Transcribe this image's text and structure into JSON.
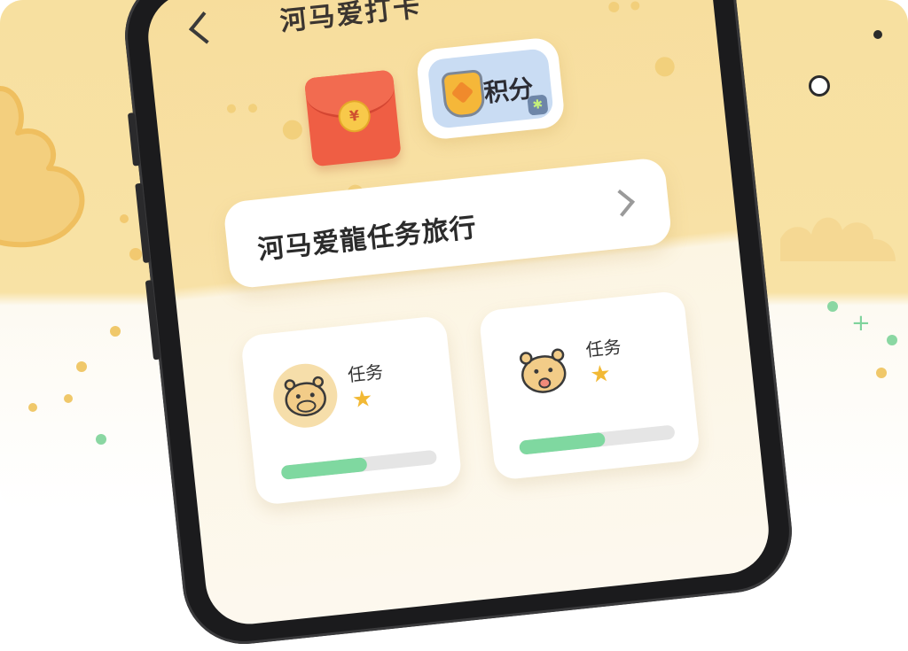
{
  "header": {
    "title": "河马爱打卡"
  },
  "top_icons": {
    "red_packet_symbol": "¥",
    "points_label": "积分",
    "points_badge": "✱"
  },
  "banner": {
    "title": "河马爱龍任务旅行"
  },
  "task_cards": [
    {
      "label": "任务",
      "stars": 1,
      "progress": 0.55
    },
    {
      "label": "任务",
      "stars": 1,
      "progress": 0.55
    }
  ],
  "colors": {
    "background_yellow": "#f7dd9c",
    "red_packet": "#ef5e44",
    "points_tile": "#c9dcf3",
    "progress_green": "#7fd8a0",
    "star_gold": "#f2b935"
  },
  "icons": [
    "back-icon",
    "red-packet-icon",
    "shield-icon",
    "sparkle-icon",
    "chevron-right-icon",
    "hippo-avatar-icon",
    "star-icon"
  ]
}
